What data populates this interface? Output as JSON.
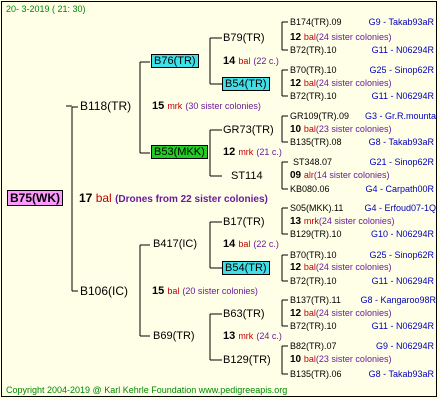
{
  "header": {
    "date_text": "20-  3-2019 (  21: 30)"
  },
  "footer": {
    "copyright": "Copyright 2004-2019 @ Karl Kehrle Foundation   www.pedigreeapis.org"
  },
  "root": {
    "name": "B75(WK)",
    "count": "17",
    "type": "bal",
    "note": "(Drones from 22 sister colonies)"
  },
  "gen1": [
    {
      "name": "B118(TR)",
      "count": "15",
      "type": "mrk",
      "note": "(30 sister colonies)"
    },
    {
      "name": "B106(IC)",
      "count": "15",
      "type": "bal",
      "note": "(20 sister colonies)"
    }
  ],
  "gen2": [
    {
      "name": "B76(TR)",
      "count": "14",
      "type": "bal",
      "note": "(22 c.)"
    },
    {
      "name": "B53(MKK)",
      "count": "12",
      "type": "mrk",
      "note": "(21 c.)"
    },
    {
      "name": "B417(IC)",
      "count": "14",
      "type": "bal",
      "note": "(22 c.)"
    },
    {
      "name": "B69(TR)",
      "count": "13",
      "type": "mrk",
      "note": "(24 c.)"
    }
  ],
  "gen3": [
    {
      "name": "B79(TR)",
      "count": "12",
      "type": "bal",
      "note": "(24 sister colonies)"
    },
    {
      "name": "B54(TR)",
      "count": "12",
      "type": "bal",
      "note": "(24 sister colonies)"
    },
    {
      "name": "GR73(TR)",
      "count": "10",
      "type": "bal",
      "note": "(23 sister colonies)"
    },
    {
      "name": "ST114",
      "count": "09",
      "type": "alr",
      "note": "(14 sister colonies)"
    },
    {
      "name": "B17(TR)",
      "count": "13",
      "type": "mrk",
      "note": "(24 sister colonies)"
    },
    {
      "name": "B54(TR)",
      "count": "12",
      "type": "bal",
      "note": "(24 sister colonies)"
    },
    {
      "name": "B63(TR)",
      "count": "12",
      "type": "bal",
      "note": "(24 sister colonies)"
    },
    {
      "name": "B129(TR)",
      "count": "10",
      "type": "bal",
      "note": "(23 sister colonies)"
    }
  ],
  "gen4": [
    {
      "name": "B174(TR).09",
      "info": "G9 - Takab93aR"
    },
    {
      "name": "B72(TR).10",
      "info": "G11 - N06294R"
    },
    {
      "name": "B70(TR).10",
      "info": "G25 - Sinop62R"
    },
    {
      "name": "B72(TR).10",
      "info": "G11 - N06294R"
    },
    {
      "name": "GR109(TR).09",
      "info": "G3 - Gr.R.mounta"
    },
    {
      "name": "B135(TR).08",
      "info": "G8 - Takab93aR"
    },
    {
      "name": "ST348.07",
      "info": "G21 - Sinop62R"
    },
    {
      "name": "KB080.06",
      "info": "G4 - Carpath00R"
    },
    {
      "name": "S05(MKK).11",
      "info": "G4 - Erfoud07-1Q"
    },
    {
      "name": "B129(TR).10",
      "info": "G10 - N06294R"
    },
    {
      "name": "B70(TR).10",
      "info": "G25 - Sinop62R"
    },
    {
      "name": "B72(TR).10",
      "info": "G11 - N06294R"
    },
    {
      "name": "B137(TR).11",
      "info": "G8 - Kangaroo98R"
    },
    {
      "name": "B72(TR).10",
      "info": "G11 - N06294R"
    },
    {
      "name": "B82(TR).07",
      "info": "G9 - N06294R"
    },
    {
      "name": "B135(TR).06",
      "info": "G8 - Takab93aR"
    }
  ]
}
